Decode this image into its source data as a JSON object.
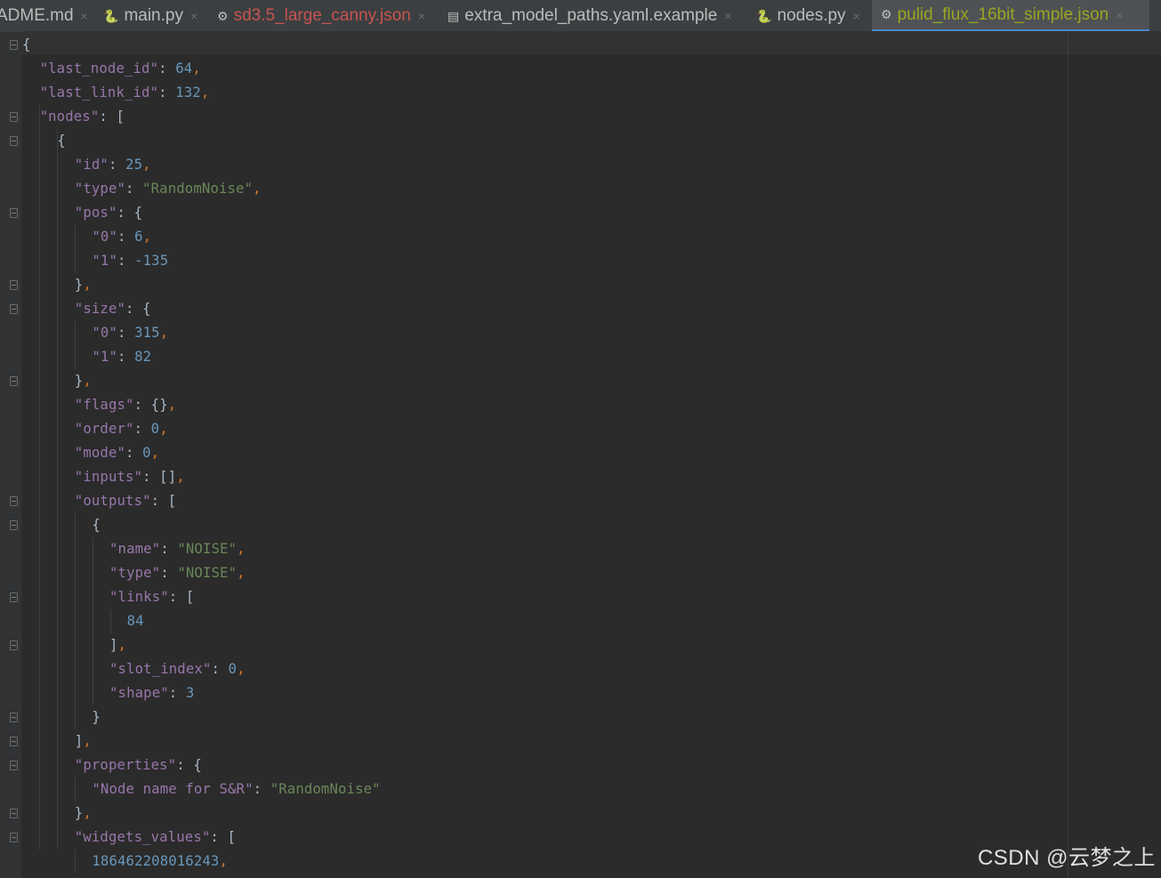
{
  "tabs": [
    {
      "label": "ADME.md",
      "icon": "markdown-file-icon",
      "close": "×",
      "glyph": ""
    },
    {
      "label": "main.py",
      "icon": "python-file-icon",
      "close": "×",
      "glyph": "🐍"
    },
    {
      "label": "sd3.5_large_canny.json",
      "icon": "json-file-icon",
      "close": "×",
      "glyph": "⚙"
    },
    {
      "label": "extra_model_paths.yaml.example",
      "icon": "text-file-icon",
      "close": "×",
      "glyph": "▤"
    },
    {
      "label": "nodes.py",
      "icon": "python-file-icon",
      "close": "×",
      "glyph": "🐍"
    },
    {
      "label": "pulid_flux_16bit_simple.json",
      "icon": "json-file-icon",
      "close": "×",
      "glyph": "⚙"
    }
  ],
  "active_tab": "pulid_flux_16bit_simple.json",
  "code_lines": [
    "{",
    "\"last_node_id\": 64,",
    "\"last_link_id\": 132,",
    "\"nodes\": [",
    "{",
    "\"id\": 25,",
    "\"type\": \"RandomNoise\",",
    "\"pos\": {",
    "\"0\": 6,",
    "\"1\": -135",
    "},",
    "\"size\": {",
    "\"0\": 315,",
    "\"1\": 82",
    "},",
    "\"flags\": {},",
    "\"order\": 0,",
    "\"mode\": 0,",
    "\"inputs\": [],",
    "\"outputs\": [",
    "{",
    "\"name\": \"NOISE\",",
    "\"type\": \"NOISE\",",
    "\"links\": [",
    "84",
    "],",
    "\"slot_index\": 0,",
    "\"shape\": 3",
    "}",
    "],",
    "\"properties\": {",
    "\"Node name for S&R\": \"RandomNoise\"",
    "},",
    "\"widgets_values\": [",
    "186462208016243,"
  ],
  "watermark": "CSDN @云梦之上",
  "colors": {
    "background": "#2b2b2b",
    "json_key": "#9876aa",
    "json_string": "#6a8759",
    "json_number": "#6897bb",
    "punctuation": "#cc7832",
    "active_tab_label": "#9aa521",
    "modified_tab_label": "#c75450"
  }
}
